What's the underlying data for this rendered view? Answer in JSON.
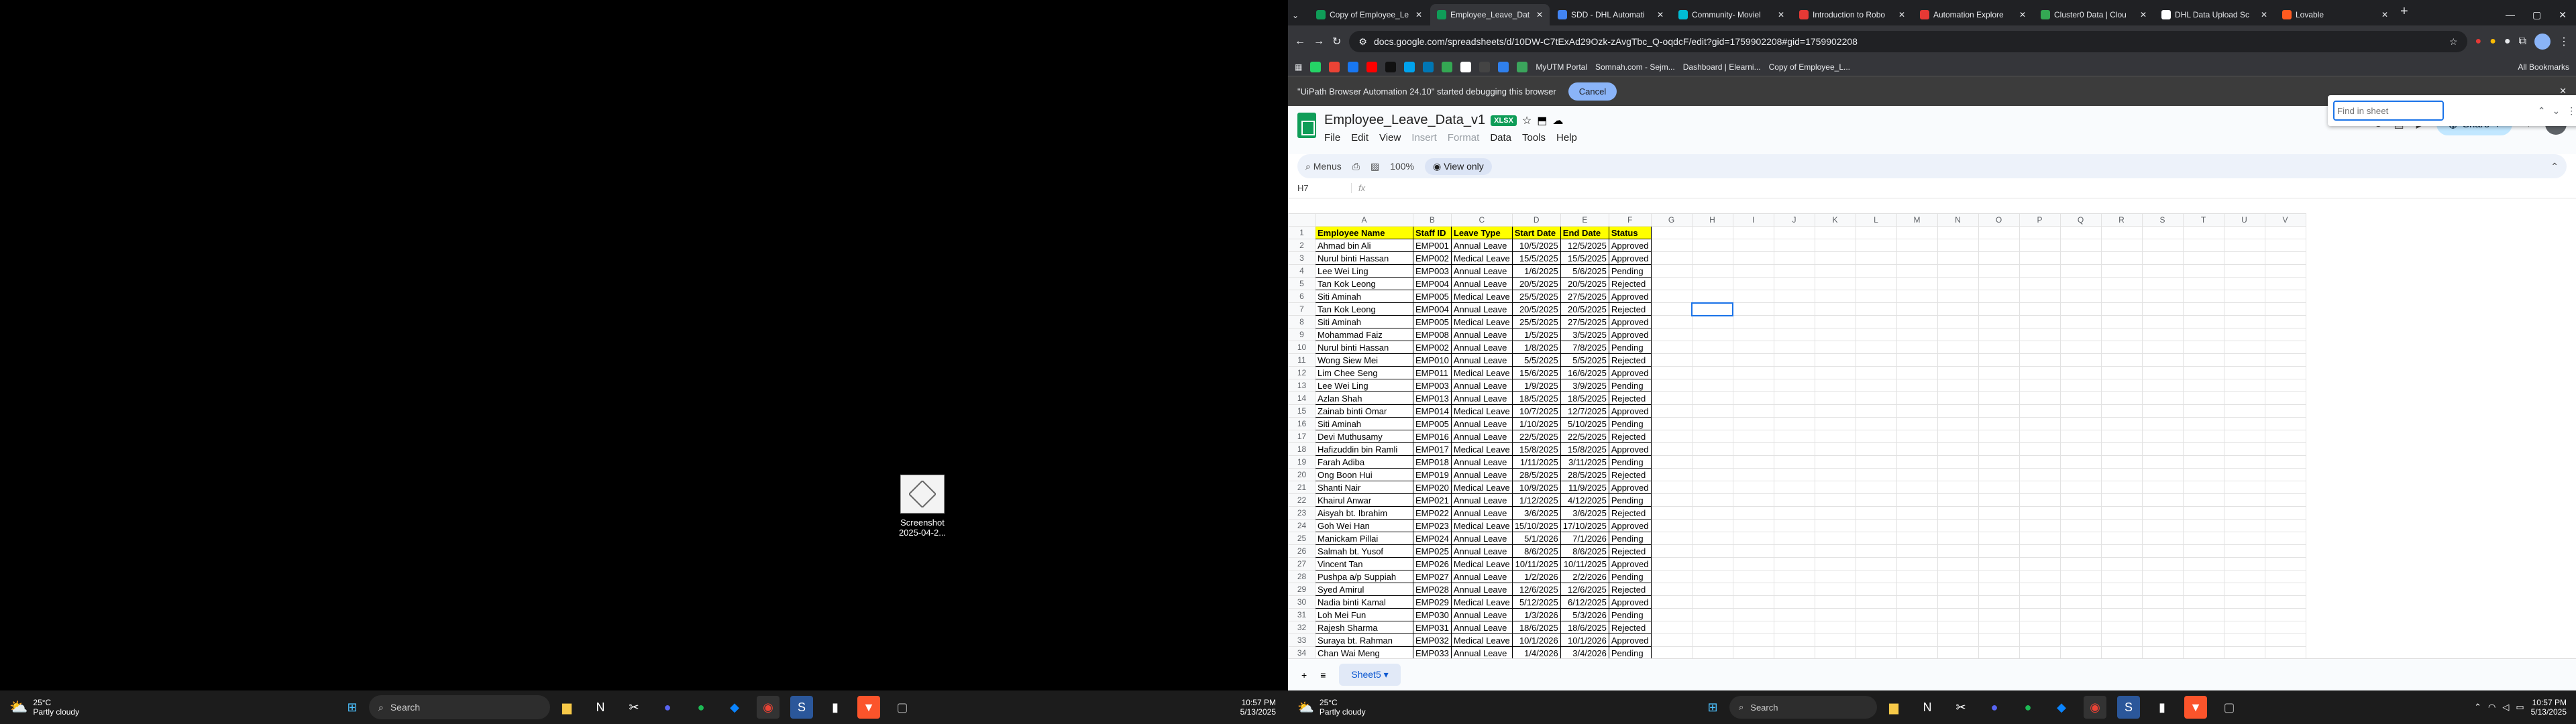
{
  "desktop": {
    "file_icon_label_1": "Screenshot",
    "file_icon_label_2": "2025-04-2...",
    "taskbar": {
      "weather_temp": "25°C",
      "weather_desc": "Partly cloudy",
      "search_placeholder": "Search",
      "time": "10:57 PM",
      "date": "5/13/2025"
    }
  },
  "browser": {
    "tabs": [
      {
        "label": "Copy of Employee_Le",
        "color": "#0f9d58"
      },
      {
        "label": "Employee_Leave_Dat",
        "color": "#0f9d58",
        "active": true
      },
      {
        "label": "SDD - DHL Automati",
        "color": "#4285f4"
      },
      {
        "label": "Community- Moviel",
        "color": "#00bcd4"
      },
      {
        "label": "Introduction to Robo",
        "color": "#e53935"
      },
      {
        "label": "Automation Explore",
        "color": "#e53935"
      },
      {
        "label": "Cluster0 Data | Clou",
        "color": "#34a853"
      },
      {
        "label": "DHL Data Upload Sc",
        "color": "#ffffff"
      },
      {
        "label": "Lovable",
        "color": "#ff5a1f"
      }
    ],
    "url": "docs.google.com/spreadsheets/d/10DW-C7tExAd29Ozk-zAvgTbc_Q-oqdcF/edit?gid=1759902208#gid=1759902208",
    "bookmarks": [
      "MyUTM Portal",
      "Somnah.com - Sejm...",
      "Dashboard | Elearni...",
      "Copy of Employee_L..."
    ],
    "all_bookmarks": "All Bookmarks",
    "infobar_text": "\"UiPath Browser Automation 24.10\" started debugging this browser",
    "infobar_cancel": "Cancel"
  },
  "sheet": {
    "title": "Employee_Leave_Data_v1",
    "badge": "XLSX",
    "menu": [
      "File",
      "Edit",
      "View",
      "Insert",
      "Format",
      "Data",
      "Tools",
      "Help"
    ],
    "share_label": "Share",
    "menus_label": "Menus",
    "zoom": "100%",
    "view_only": "View only",
    "cell_ref": "H7",
    "fx": "fx",
    "find_placeholder": "Find in sheet",
    "sheet_tab": "Sheet5",
    "columns": [
      "A",
      "B",
      "C",
      "D",
      "E",
      "F",
      "G",
      "H",
      "I",
      "J",
      "K",
      "L",
      "M",
      "N",
      "O",
      "P",
      "Q",
      "R",
      "S",
      "T",
      "U",
      "V"
    ],
    "header": [
      "Employee Name",
      "Staff ID",
      "Leave Type",
      "Start Date",
      "End Date",
      "Status"
    ],
    "rows": [
      [
        "Ahmad bin Ali",
        "EMP001",
        "Annual Leave",
        "10/5/2025",
        "12/5/2025",
        "Approved"
      ],
      [
        "Nurul binti Hassan",
        "EMP002",
        "Medical Leave",
        "15/5/2025",
        "15/5/2025",
        "Approved"
      ],
      [
        "Lee Wei Ling",
        "EMP003",
        "Annual Leave",
        "1/6/2025",
        "5/6/2025",
        "Pending"
      ],
      [
        "Tan Kok Leong",
        "EMP004",
        "Annual Leave",
        "20/5/2025",
        "20/5/2025",
        "Rejected"
      ],
      [
        "Siti Aminah",
        "EMP005",
        "Medical Leave",
        "25/5/2025",
        "27/5/2025",
        "Approved"
      ],
      [
        "Tan Kok Leong",
        "EMP004",
        "Annual Leave",
        "20/5/2025",
        "20/5/2025",
        "Rejected"
      ],
      [
        "Siti Aminah",
        "EMP005",
        "Medical Leave",
        "25/5/2025",
        "27/5/2025",
        "Approved"
      ],
      [
        "Mohammad Faiz",
        "EMP008",
        "Annual Leave",
        "1/5/2025",
        "3/5/2025",
        "Approved"
      ],
      [
        "Nurul binti Hassan",
        "EMP002",
        "Annual Leave",
        "1/8/2025",
        "7/8/2025",
        "Pending"
      ],
      [
        "Wong Siew Mei",
        "EMP010",
        "Annual Leave",
        "5/5/2025",
        "5/5/2025",
        "Rejected"
      ],
      [
        "Lim Chee Seng",
        "EMP011",
        "Medical Leave",
        "15/6/2025",
        "16/6/2025",
        "Approved"
      ],
      [
        "Lee Wei Ling",
        "EMP003",
        "Annual Leave",
        "1/9/2025",
        "3/9/2025",
        "Pending"
      ],
      [
        "Azlan Shah",
        "EMP013",
        "Annual Leave",
        "18/5/2025",
        "18/5/2025",
        "Rejected"
      ],
      [
        "Zainab binti Omar",
        "EMP014",
        "Medical Leave",
        "10/7/2025",
        "12/7/2025",
        "Approved"
      ],
      [
        "Siti Aminah",
        "EMP005",
        "Annual Leave",
        "1/10/2025",
        "5/10/2025",
        "Pending"
      ],
      [
        "Devi Muthusamy",
        "EMP016",
        "Annual Leave",
        "22/5/2025",
        "22/5/2025",
        "Rejected"
      ],
      [
        "Hafizuddin bin Ramli",
        "EMP017",
        "Medical Leave",
        "15/8/2025",
        "15/8/2025",
        "Approved"
      ],
      [
        "Farah Adiba",
        "EMP018",
        "Annual Leave",
        "1/11/2025",
        "3/11/2025",
        "Pending"
      ],
      [
        "Ong Boon Hui",
        "EMP019",
        "Annual Leave",
        "28/5/2025",
        "28/5/2025",
        "Rejected"
      ],
      [
        "Shanti Nair",
        "EMP020",
        "Medical Leave",
        "10/9/2025",
        "11/9/2025",
        "Approved"
      ],
      [
        "Khairul Anwar",
        "EMP021",
        "Annual Leave",
        "1/12/2025",
        "4/12/2025",
        "Pending"
      ],
      [
        "Aisyah bt. Ibrahim",
        "EMP022",
        "Annual Leave",
        "3/6/2025",
        "3/6/2025",
        "Rejected"
      ],
      [
        "Goh Wei Han",
        "EMP023",
        "Medical Leave",
        "15/10/2025",
        "17/10/2025",
        "Approved"
      ],
      [
        "Manickam Pillai",
        "EMP024",
        "Annual Leave",
        "5/1/2026",
        "7/1/2026",
        "Pending"
      ],
      [
        "Salmah bt. Yusof",
        "EMP025",
        "Annual Leave",
        "8/6/2025",
        "8/6/2025",
        "Rejected"
      ],
      [
        "Vincent Tan",
        "EMP026",
        "Medical Leave",
        "10/11/2025",
        "10/11/2025",
        "Approved"
      ],
      [
        "Pushpa a/p Suppiah",
        "EMP027",
        "Annual Leave",
        "1/2/2026",
        "2/2/2026",
        "Pending"
      ],
      [
        "Syed Amirul",
        "EMP028",
        "Annual Leave",
        "12/6/2025",
        "12/6/2025",
        "Rejected"
      ],
      [
        "Nadia binti Kamal",
        "EMP029",
        "Medical Leave",
        "5/12/2025",
        "6/12/2025",
        "Approved"
      ],
      [
        "Loh Mei Fun",
        "EMP030",
        "Annual Leave",
        "1/3/2026",
        "5/3/2026",
        "Pending"
      ],
      [
        "Rajesh Sharma",
        "EMP031",
        "Annual Leave",
        "18/6/2025",
        "18/6/2025",
        "Rejected"
      ],
      [
        "Suraya bt. Rahman",
        "EMP032",
        "Medical Leave",
        "10/1/2026",
        "10/1/2026",
        "Approved"
      ],
      [
        "Chan Wai Meng",
        "EMP033",
        "Annual Leave",
        "1/4/2026",
        "3/4/2026",
        "Pending"
      ]
    ],
    "row_numbers": [
      "1",
      "2",
      "3",
      "4",
      "5",
      "6",
      "7",
      "8",
      "9",
      "10",
      "11",
      "12",
      "13",
      "14",
      "15",
      "16",
      "17",
      "18",
      "19",
      "20",
      "21",
      "22",
      "23",
      "24",
      "25",
      "26",
      "27",
      "28",
      "29",
      "30",
      "31",
      "32",
      "33",
      "34"
    ]
  },
  "accent": "#0f9d58",
  "header_fill": "#ffff00"
}
